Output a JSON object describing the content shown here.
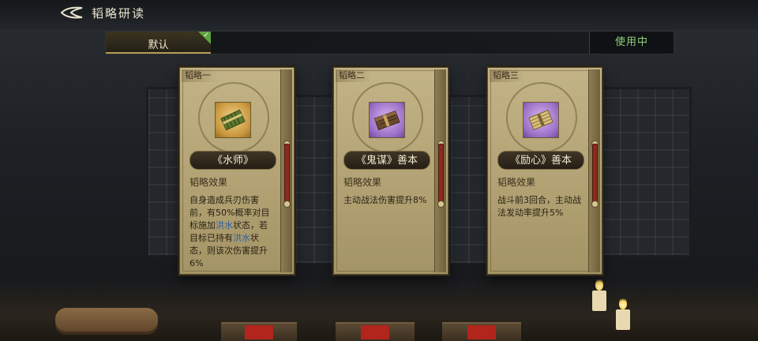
{
  "header": {
    "title": "韬略研读"
  },
  "tabs": {
    "default_label": "默认",
    "in_use_label": "使用中"
  },
  "cards": [
    {
      "tag": "韬略一",
      "name": "《水师》",
      "effect_title": "韬略效果",
      "effect_parts": [
        "自身造成兵刃伤害前，有50%概率对目标施加",
        "洪水",
        "状态，若目标已持有",
        "洪水",
        "状态，则该次伤害提升6%"
      ]
    },
    {
      "tag": "韬略二",
      "name": "《鬼谋》善本",
      "effect_title": "韬略效果",
      "effect_text": "主动战法伤害提升8%"
    },
    {
      "tag": "韬略三",
      "name": "《励心》善本",
      "effect_title": "韬略效果",
      "effect_text": "战斗前3回合，主动战法发动率提升5%"
    }
  ],
  "colors": {
    "accent_green": "#8fd27b",
    "highlight_blue": "#2d5fa8",
    "check_green": "#5fa33e"
  },
  "icons": [
    "back-arrow-icon",
    "checkmark-icon",
    "bamboo-scroll-icon",
    "book-icon"
  ]
}
